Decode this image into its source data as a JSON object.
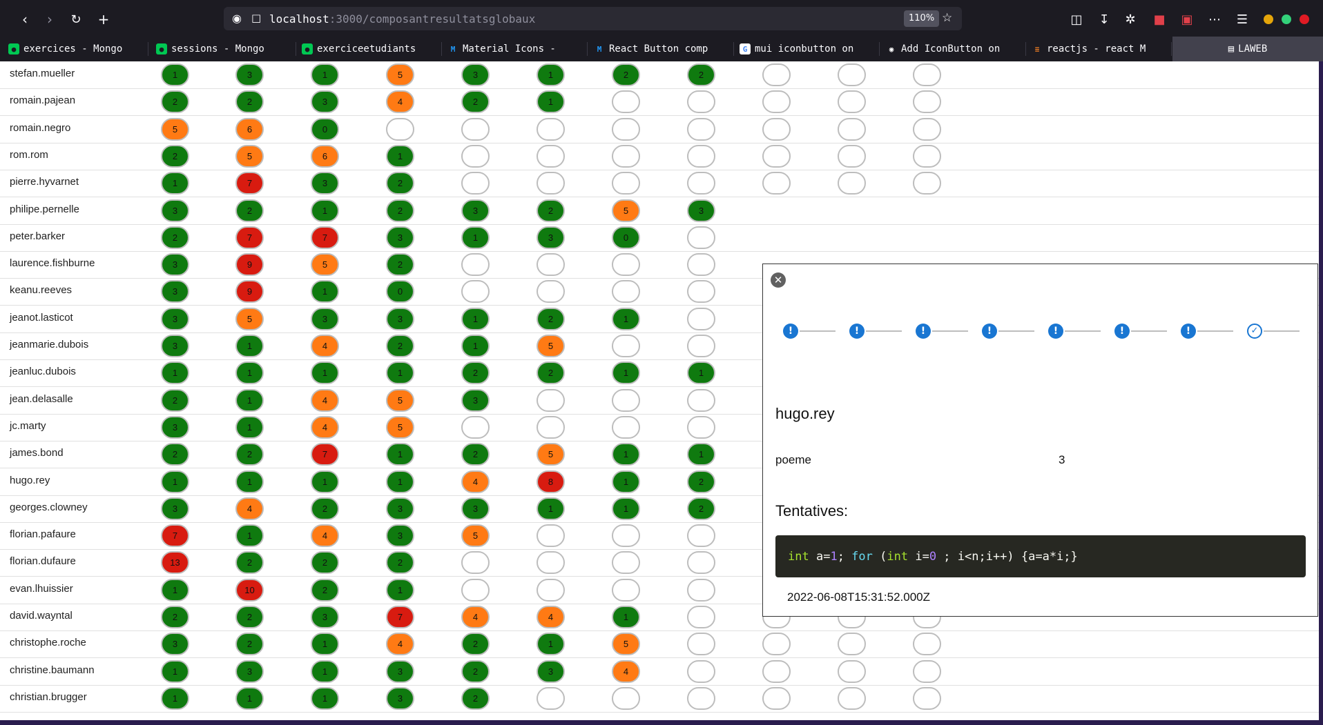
{
  "browser": {
    "url_host": "localhost",
    "url_path": ":3000/composantresultatsglobaux",
    "zoom": "110%",
    "tabs": [
      {
        "label": "exercices - Mongo",
        "icon": "leaf-icon"
      },
      {
        "label": "sessions - Mongo",
        "icon": "leaf-icon"
      },
      {
        "label": "exerciceetudiants",
        "icon": "leaf-icon"
      },
      {
        "label": "Material Icons -",
        "icon": "mui-icon"
      },
      {
        "label": "React Button comp",
        "icon": "mui-icon"
      },
      {
        "label": "mui iconbutton on",
        "icon": "google-icon"
      },
      {
        "label": "Add IconButton on",
        "icon": "github-icon"
      },
      {
        "label": "reactjs - react M",
        "icon": "stackoverflow-icon"
      }
    ],
    "active_tab": "LAWEB"
  },
  "colors": {
    "green": "#0f7a0f",
    "orange": "#ff7a14",
    "red": "#d81b10",
    "stepper_blue": "#1976d2"
  },
  "rows": [
    {
      "name": "stefan.mueller",
      "scores": [
        [
          "g",
          "1"
        ],
        [
          "g",
          "3"
        ],
        [
          "g",
          "1"
        ],
        [
          "o",
          "5"
        ],
        [
          "g",
          "3"
        ],
        [
          "g",
          "1"
        ],
        [
          "g",
          "2"
        ],
        [
          "g",
          "2"
        ],
        [
          "e",
          ""
        ],
        [
          "e",
          ""
        ],
        [
          "e",
          ""
        ]
      ]
    },
    {
      "name": "romain.pajean",
      "scores": [
        [
          "g",
          "2"
        ],
        [
          "g",
          "2"
        ],
        [
          "g",
          "3"
        ],
        [
          "o",
          "4"
        ],
        [
          "g",
          "2"
        ],
        [
          "g",
          "1"
        ],
        [
          "e",
          ""
        ],
        [
          "e",
          ""
        ],
        [
          "e",
          ""
        ],
        [
          "e",
          ""
        ],
        [
          "e",
          ""
        ]
      ]
    },
    {
      "name": "romain.negro",
      "scores": [
        [
          "o",
          "5"
        ],
        [
          "o",
          "6"
        ],
        [
          "g",
          "0"
        ],
        [
          "e",
          ""
        ],
        [
          "e",
          ""
        ],
        [
          "e",
          ""
        ],
        [
          "e",
          ""
        ],
        [
          "e",
          ""
        ],
        [
          "e",
          ""
        ],
        [
          "e",
          ""
        ],
        [
          "e",
          ""
        ]
      ]
    },
    {
      "name": "rom.rom",
      "scores": [
        [
          "g",
          "2"
        ],
        [
          "o",
          "5"
        ],
        [
          "o",
          "6"
        ],
        [
          "g",
          "1"
        ],
        [
          "e",
          ""
        ],
        [
          "e",
          ""
        ],
        [
          "e",
          ""
        ],
        [
          "e",
          ""
        ],
        [
          "e",
          ""
        ],
        [
          "e",
          ""
        ],
        [
          "e",
          ""
        ]
      ]
    },
    {
      "name": "pierre.hyvarnet",
      "scores": [
        [
          "g",
          "1"
        ],
        [
          "r",
          "7"
        ],
        [
          "g",
          "3"
        ],
        [
          "g",
          "2"
        ],
        [
          "e",
          ""
        ],
        [
          "e",
          ""
        ],
        [
          "e",
          ""
        ],
        [
          "e",
          ""
        ],
        [
          "e",
          ""
        ],
        [
          "e",
          ""
        ],
        [
          "e",
          ""
        ]
      ]
    },
    {
      "name": "philipe.pernelle",
      "scores": [
        [
          "g",
          "3"
        ],
        [
          "g",
          "2"
        ],
        [
          "g",
          "1"
        ],
        [
          "g",
          "2"
        ],
        [
          "g",
          "3"
        ],
        [
          "g",
          "2"
        ],
        [
          "o",
          "5"
        ],
        [
          "g",
          "3"
        ]
      ]
    },
    {
      "name": "peter.barker",
      "scores": [
        [
          "g",
          "2"
        ],
        [
          "r",
          "7"
        ],
        [
          "r",
          "7"
        ],
        [
          "g",
          "3"
        ],
        [
          "g",
          "1"
        ],
        [
          "g",
          "3"
        ],
        [
          "g",
          "0"
        ],
        [
          "e",
          ""
        ]
      ]
    },
    {
      "name": "laurence.fishburne",
      "scores": [
        [
          "g",
          "3"
        ],
        [
          "r",
          "9"
        ],
        [
          "o",
          "5"
        ],
        [
          "g",
          "2"
        ],
        [
          "e",
          ""
        ],
        [
          "e",
          ""
        ],
        [
          "e",
          ""
        ],
        [
          "e",
          ""
        ]
      ]
    },
    {
      "name": "keanu.reeves",
      "scores": [
        [
          "g",
          "3"
        ],
        [
          "r",
          "9"
        ],
        [
          "g",
          "1"
        ],
        [
          "g",
          "0"
        ],
        [
          "e",
          ""
        ],
        [
          "e",
          ""
        ],
        [
          "e",
          ""
        ],
        [
          "e",
          ""
        ]
      ]
    },
    {
      "name": "jeanot.lasticot",
      "scores": [
        [
          "g",
          "3"
        ],
        [
          "o",
          "5"
        ],
        [
          "g",
          "3"
        ],
        [
          "g",
          "3"
        ],
        [
          "g",
          "1"
        ],
        [
          "g",
          "2"
        ],
        [
          "g",
          "1"
        ],
        [
          "e",
          ""
        ]
      ]
    },
    {
      "name": "jeanmarie.dubois",
      "scores": [
        [
          "g",
          "3"
        ],
        [
          "g",
          "1"
        ],
        [
          "o",
          "4"
        ],
        [
          "g",
          "2"
        ],
        [
          "g",
          "1"
        ],
        [
          "o",
          "5"
        ],
        [
          "e",
          ""
        ],
        [
          "e",
          ""
        ]
      ]
    },
    {
      "name": "jeanluc.dubois",
      "scores": [
        [
          "g",
          "1"
        ],
        [
          "g",
          "1"
        ],
        [
          "g",
          "1"
        ],
        [
          "g",
          "1"
        ],
        [
          "g",
          "2"
        ],
        [
          "g",
          "2"
        ],
        [
          "g",
          "1"
        ],
        [
          "g",
          "1"
        ]
      ]
    },
    {
      "name": "jean.delasalle",
      "scores": [
        [
          "g",
          "2"
        ],
        [
          "g",
          "1"
        ],
        [
          "o",
          "4"
        ],
        [
          "o",
          "5"
        ],
        [
          "g",
          "3"
        ],
        [
          "e",
          ""
        ],
        [
          "e",
          ""
        ],
        [
          "e",
          ""
        ]
      ]
    },
    {
      "name": "jc.marty",
      "scores": [
        [
          "g",
          "3"
        ],
        [
          "g",
          "1"
        ],
        [
          "o",
          "4"
        ],
        [
          "o",
          "5"
        ],
        [
          "e",
          ""
        ],
        [
          "e",
          ""
        ],
        [
          "e",
          ""
        ],
        [
          "e",
          ""
        ]
      ]
    },
    {
      "name": "james.bond",
      "scores": [
        [
          "g",
          "2"
        ],
        [
          "g",
          "2"
        ],
        [
          "r",
          "7"
        ],
        [
          "g",
          "1"
        ],
        [
          "g",
          "2"
        ],
        [
          "o",
          "5"
        ],
        [
          "g",
          "1"
        ],
        [
          "g",
          "1"
        ]
      ]
    },
    {
      "name": "hugo.rey",
      "scores": [
        [
          "g",
          "1"
        ],
        [
          "g",
          "1"
        ],
        [
          "g",
          "1"
        ],
        [
          "g",
          "1"
        ],
        [
          "o",
          "4"
        ],
        [
          "r",
          "8"
        ],
        [
          "g",
          "1"
        ],
        [
          "g",
          "2"
        ]
      ]
    },
    {
      "name": "georges.clowney",
      "scores": [
        [
          "g",
          "3"
        ],
        [
          "o",
          "4"
        ],
        [
          "g",
          "2"
        ],
        [
          "g",
          "3"
        ],
        [
          "g",
          "3"
        ],
        [
          "g",
          "1"
        ],
        [
          "g",
          "1"
        ],
        [
          "g",
          "2"
        ]
      ]
    },
    {
      "name": "florian.pafaure",
      "scores": [
        [
          "r",
          "7"
        ],
        [
          "g",
          "1"
        ],
        [
          "o",
          "4"
        ],
        [
          "g",
          "3"
        ],
        [
          "o",
          "5"
        ],
        [
          "e",
          ""
        ],
        [
          "e",
          ""
        ],
        [
          "e",
          ""
        ]
      ]
    },
    {
      "name": "florian.dufaure",
      "scores": [
        [
          "r",
          "13"
        ],
        [
          "g",
          "2"
        ],
        [
          "g",
          "2"
        ],
        [
          "g",
          "2"
        ],
        [
          "e",
          ""
        ],
        [
          "e",
          ""
        ],
        [
          "e",
          ""
        ],
        [
          "e",
          ""
        ],
        [
          "e",
          ""
        ],
        [
          "e",
          ""
        ],
        [
          "e",
          ""
        ]
      ]
    },
    {
      "name": "evan.lhuissier",
      "scores": [
        [
          "g",
          "1"
        ],
        [
          "r",
          "10"
        ],
        [
          "g",
          "2"
        ],
        [
          "g",
          "1"
        ],
        [
          "e",
          ""
        ],
        [
          "e",
          ""
        ],
        [
          "e",
          ""
        ],
        [
          "e",
          ""
        ],
        [
          "e",
          ""
        ],
        [
          "e",
          ""
        ],
        [
          "e",
          ""
        ]
      ]
    },
    {
      "name": "david.wayntal",
      "scores": [
        [
          "g",
          "2"
        ],
        [
          "g",
          "2"
        ],
        [
          "g",
          "3"
        ],
        [
          "r",
          "7"
        ],
        [
          "o",
          "4"
        ],
        [
          "o",
          "4"
        ],
        [
          "g",
          "1"
        ],
        [
          "e",
          ""
        ],
        [
          "e",
          ""
        ],
        [
          "e",
          ""
        ],
        [
          "e",
          ""
        ]
      ]
    },
    {
      "name": "christophe.roche",
      "scores": [
        [
          "g",
          "3"
        ],
        [
          "g",
          "2"
        ],
        [
          "g",
          "1"
        ],
        [
          "o",
          "4"
        ],
        [
          "g",
          "2"
        ],
        [
          "g",
          "1"
        ],
        [
          "o",
          "5"
        ],
        [
          "e",
          ""
        ],
        [
          "e",
          ""
        ],
        [
          "e",
          ""
        ],
        [
          "e",
          ""
        ]
      ]
    },
    {
      "name": "christine.baumann",
      "scores": [
        [
          "g",
          "1"
        ],
        [
          "g",
          "3"
        ],
        [
          "g",
          "1"
        ],
        [
          "g",
          "3"
        ],
        [
          "g",
          "2"
        ],
        [
          "g",
          "3"
        ],
        [
          "o",
          "4"
        ],
        [
          "e",
          ""
        ],
        [
          "e",
          ""
        ],
        [
          "e",
          ""
        ],
        [
          "e",
          ""
        ]
      ]
    },
    {
      "name": "christian.brugger",
      "scores": [
        [
          "g",
          "1"
        ],
        [
          "g",
          "1"
        ],
        [
          "g",
          "1"
        ],
        [
          "g",
          "3"
        ],
        [
          "g",
          "2"
        ],
        [
          "e",
          ""
        ],
        [
          "e",
          ""
        ],
        [
          "e",
          ""
        ],
        [
          "e",
          ""
        ],
        [
          "e",
          ""
        ],
        [
          "e",
          ""
        ]
      ]
    }
  ],
  "modal": {
    "steps": [
      "error",
      "error",
      "error",
      "error",
      "error",
      "error",
      "error",
      "success"
    ],
    "student": "hugo.rey",
    "exercise": "poeme",
    "exercise_value": "3",
    "tentatives_title": "Tentatives:",
    "code": "int a=1; for (int i=0 ; i<n;i++) {a=a*i;}",
    "timestamp": "2022-06-08T15:31:52.000Z"
  }
}
